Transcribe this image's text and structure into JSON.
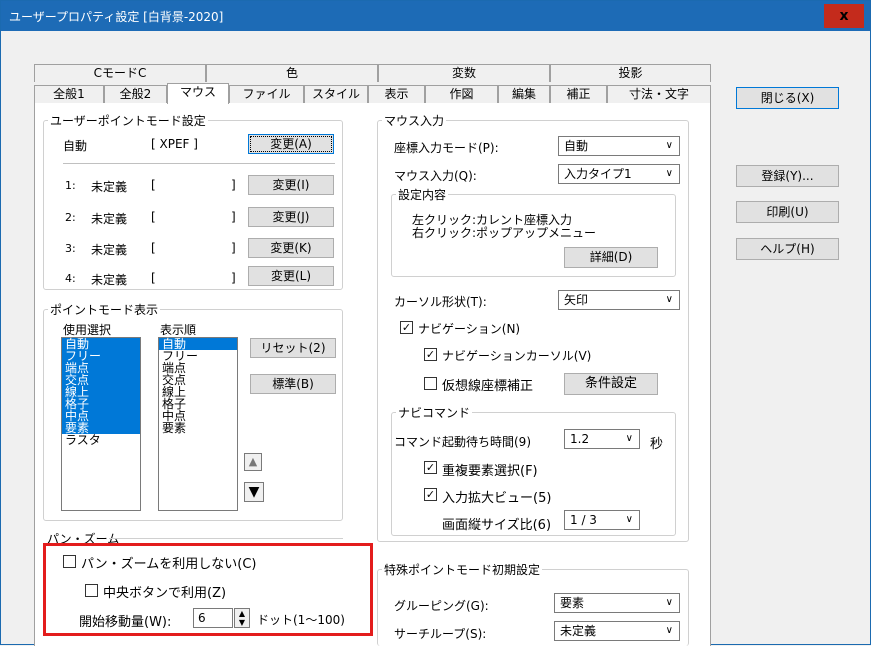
{
  "window": {
    "title": "ユーザープロパティ設定 [白背景-2020]",
    "close": "x"
  },
  "tabs_top": [
    {
      "label": "CモードC"
    },
    {
      "label": "色"
    },
    {
      "label": "変数"
    },
    {
      "label": "投影"
    }
  ],
  "tabs_bottom": [
    {
      "label": "全般1"
    },
    {
      "label": "全般2"
    },
    {
      "label": "マウス"
    },
    {
      "label": "ファイル"
    },
    {
      "label": "スタイル"
    },
    {
      "label": "表示"
    },
    {
      "label": "作図"
    },
    {
      "label": "編集"
    },
    {
      "label": "補正"
    },
    {
      "label": "寸法・文字"
    }
  ],
  "side_buttons": {
    "close": "閉じる(X)",
    "register": "登録(Y)...",
    "print": "印刷(U)",
    "help": "ヘルプ(H)"
  },
  "user_point_mode": {
    "group_label": "ユーザーポイントモード設定",
    "auto_label": "自動",
    "auto_value": "[ XPEF    ]",
    "change_btn": "変更(A)",
    "rows": [
      {
        "num": "1:",
        "label": "未定義",
        "bracket_l": "[",
        "bracket_r": "]",
        "btn": "変更(I)"
      },
      {
        "num": "2:",
        "label": "未定義",
        "bracket_l": "[",
        "bracket_r": "]",
        "btn": "変更(J)"
      },
      {
        "num": "3:",
        "label": "未定義",
        "bracket_l": "[",
        "bracket_r": "]",
        "btn": "変更(K)"
      },
      {
        "num": "4:",
        "label": "未定義",
        "bracket_l": "[",
        "bracket_r": "]",
        "btn": "変更(L)"
      }
    ]
  },
  "point_mode_display": {
    "group_label": "ポイントモード表示",
    "use_label": "使用選択",
    "order_label": "表示順",
    "use_items": [
      {
        "label": "自動",
        "selected": true
      },
      {
        "label": "フリー",
        "selected": true
      },
      {
        "label": "端点",
        "selected": true
      },
      {
        "label": "交点",
        "selected": true
      },
      {
        "label": "線上",
        "selected": true
      },
      {
        "label": "格子",
        "selected": true
      },
      {
        "label": "中点",
        "selected": true
      },
      {
        "label": "要素",
        "selected": true
      },
      {
        "label": "ラスタ",
        "selected": false
      }
    ],
    "order_items": [
      {
        "label": "自動",
        "selected": true
      },
      {
        "label": "フリー",
        "selected": false
      },
      {
        "label": "端点",
        "selected": false
      },
      {
        "label": "交点",
        "selected": false
      },
      {
        "label": "線上",
        "selected": false
      },
      {
        "label": "格子",
        "selected": false
      },
      {
        "label": "中点",
        "selected": false
      },
      {
        "label": "要素",
        "selected": false
      }
    ],
    "reset_btn": "リセット(2)",
    "standard_btn": "標準(B)",
    "up_arrow": "▲",
    "down_arrow": "▼"
  },
  "pan_zoom": {
    "group_label": "パン・ズーム",
    "no_use_label": "パン・ズームを利用しない(C)",
    "no_use_checked": false,
    "middle_label": "中央ボタンで利用(Z)",
    "middle_checked": false,
    "start_label": "開始移動量(W):",
    "start_value": "6",
    "start_unit": "ドット(1〜100)"
  },
  "mouse_input": {
    "group_label": "マウス入力",
    "coord_mode_label": "座標入力モード(P):",
    "coord_mode_value": "自動",
    "mouse_input_label": "マウス入力(Q):",
    "mouse_input_value": "入力タイプ1",
    "settings_label": "設定内容",
    "left_click": "左クリック:カレント座標入力",
    "right_click": "右クリック:ポップアップメニュー",
    "detail_btn": "詳細(D)",
    "cursor_shape_label": "カーソル形状(T):",
    "cursor_shape_value": "矢印",
    "navigation_label": "ナビゲーション(N)",
    "navigation_checked": true,
    "nav_cursor_label": "ナビゲーションカーソル(V)",
    "nav_cursor_checked": true,
    "virtual_line_label": "仮想線座標補正",
    "virtual_line_checked": false,
    "condition_btn": "条件設定",
    "nav_command_label": "ナビコマンド",
    "wait_label": "コマンド起動待ち時間(9)",
    "wait_value": "1.2",
    "wait_unit": "秒",
    "dup_select_label": "重複要素選択(F)",
    "dup_select_checked": true,
    "zoom_view_label": "入力拡大ビュー(5)",
    "zoom_view_checked": true,
    "ratio_label": "画面縦サイズ比(6)",
    "ratio_value": "1 / 3"
  },
  "special_point": {
    "group_label": "特殊ポイントモード初期設定",
    "grouping_label": "グルーピング(G):",
    "grouping_value": "要素",
    "search_loop_label": "サーチループ(S):",
    "search_loop_value": "未定義"
  },
  "colors": {
    "accent": "#0078d7",
    "title_bar": "#1d6bb6",
    "highlight_box": "#e31c1c",
    "close_btn": "#c42b1c"
  }
}
